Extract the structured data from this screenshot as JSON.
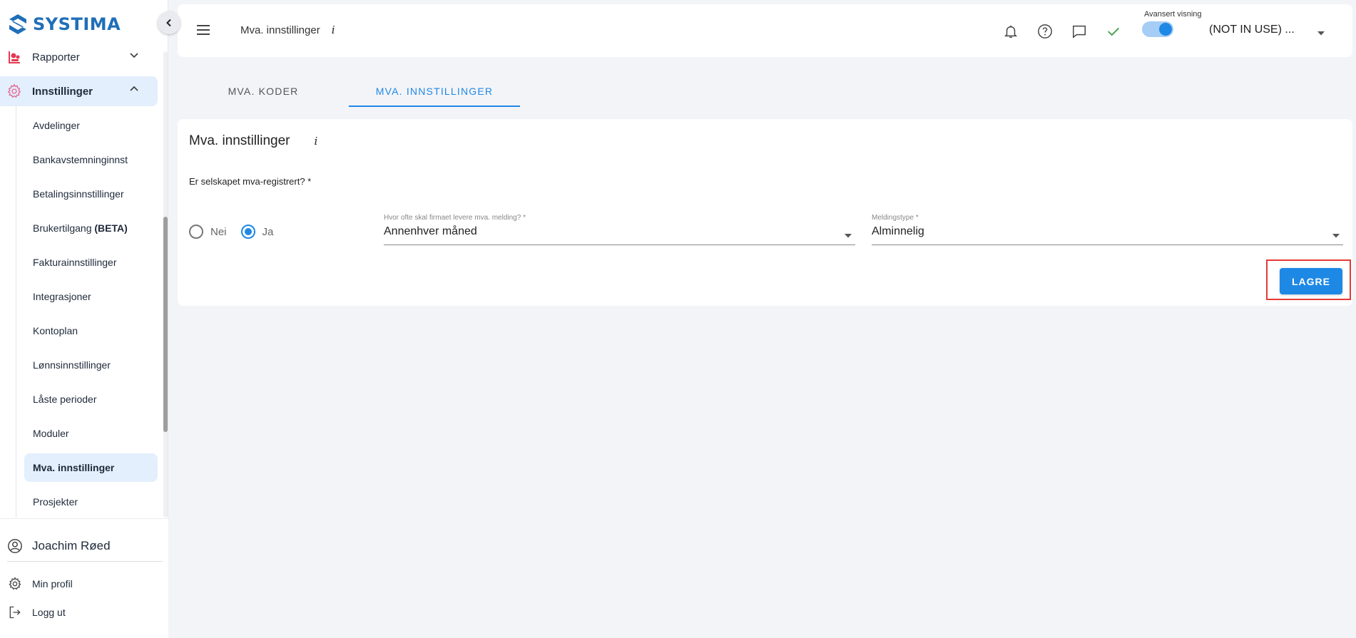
{
  "app": {
    "logo_text": "SYSTIMA"
  },
  "sidebar": {
    "items": [
      {
        "label": "Rapporter",
        "icon": "reports-icon"
      },
      {
        "label": "Innstillinger",
        "icon": "gear-icon"
      }
    ],
    "subitems": [
      {
        "label": "Avdelinger"
      },
      {
        "label": "Bankavstemninginnst"
      },
      {
        "label": "Betalingsinnstillinger"
      },
      {
        "label": "Brukertilgang",
        "badge": "(BETA)"
      },
      {
        "label": "Fakturainnstillinger"
      },
      {
        "label": "Integrasjoner"
      },
      {
        "label": "Kontoplan"
      },
      {
        "label": "Lønnsinnstillinger"
      },
      {
        "label": "Låste perioder"
      },
      {
        "label": "Moduler"
      },
      {
        "label": "Mva. innstillinger"
      },
      {
        "label": "Prosjekter"
      }
    ],
    "user": {
      "name": "Joachim Røed"
    },
    "bottom_links": [
      {
        "label": "Min profil"
      },
      {
        "label": "Logg ut"
      }
    ]
  },
  "topbar": {
    "breadcrumb": "Mva. innstillinger",
    "info_icon": "i",
    "toggle_label": "Avansert visning",
    "toggle_on": true,
    "company": "(NOT IN USE) ..."
  },
  "tabs": [
    {
      "label": "MVA. KODER"
    },
    {
      "label": "MVA. INNSTILLINGER"
    }
  ],
  "form": {
    "title": "Mva. innstillinger",
    "info_icon": "i",
    "question": "Er selskapet mva-registrert? *",
    "radio_options": [
      {
        "label": "Nei"
      },
      {
        "label": "Ja"
      }
    ],
    "selected_radio": "Ja",
    "frequency": {
      "label": "Hvor ofte skal firmaet levere mva. melding? *",
      "value": "Annenhver måned"
    },
    "type": {
      "label": "Meldingstype *",
      "value": "Alminnelig"
    },
    "save_label": "LAGRE"
  },
  "colors": {
    "accent": "#1e88e5",
    "active_bg": "#e3effc",
    "brand": "#1f6fb8",
    "check": "#43a047",
    "highlight": "#e53935"
  }
}
